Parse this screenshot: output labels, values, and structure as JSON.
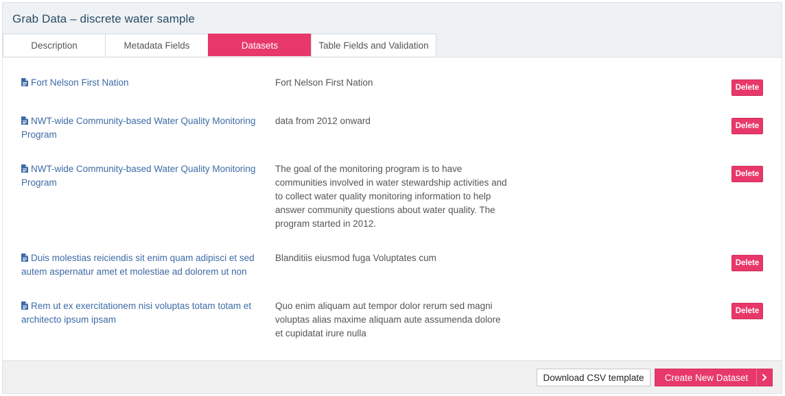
{
  "panel": {
    "title": "Grab Data – discrete water sample"
  },
  "tabs": [
    {
      "label": "Description"
    },
    {
      "label": "Metadata Fields"
    },
    {
      "label": "Datasets",
      "active": true
    },
    {
      "label": "Table Fields and Validation"
    }
  ],
  "datasets": [
    {
      "name": "Fort Nelson First Nation",
      "description": "Fort Nelson First Nation",
      "action": "Delete"
    },
    {
      "name": "NWT-wide Community-based Water Quality Monitoring Program",
      "description": "data from 2012 onward",
      "action": "Delete"
    },
    {
      "name": "NWT-wide Community-based Water Quality Monitoring Program",
      "description": "The goal of the monitoring program is to have communities involved in water stewardship activities and to collect water quality monitoring information to help answer community questions about water quality. The program started in 2012.",
      "action": "Delete"
    },
    {
      "name": "Duis molestias reiciendis sit enim quam adipisci et sed autem aspernatur amet et molestiae ad dolorem ut non",
      "description": "Blanditiis eiusmod fuga Voluptates cum",
      "action": "Delete"
    },
    {
      "name": "Rem ut ex exercitationem nisi voluptas totam totam et architecto ipsum ipsam",
      "description": "Quo enim aliquam aut tempor dolor rerum sed magni voluptas alias maxime aliquam aute assumenda dolore et cupidatat irure nulla",
      "action": "Delete"
    }
  ],
  "footer": {
    "csv_label": "Download CSV template",
    "create_label": "Create New Dataset"
  },
  "colors": {
    "accent": "#e8386a",
    "link": "#3d6aa6",
    "title": "#2c4a63"
  },
  "icons": {
    "dataset": "document-icon",
    "create": "chevron-right-icon"
  }
}
